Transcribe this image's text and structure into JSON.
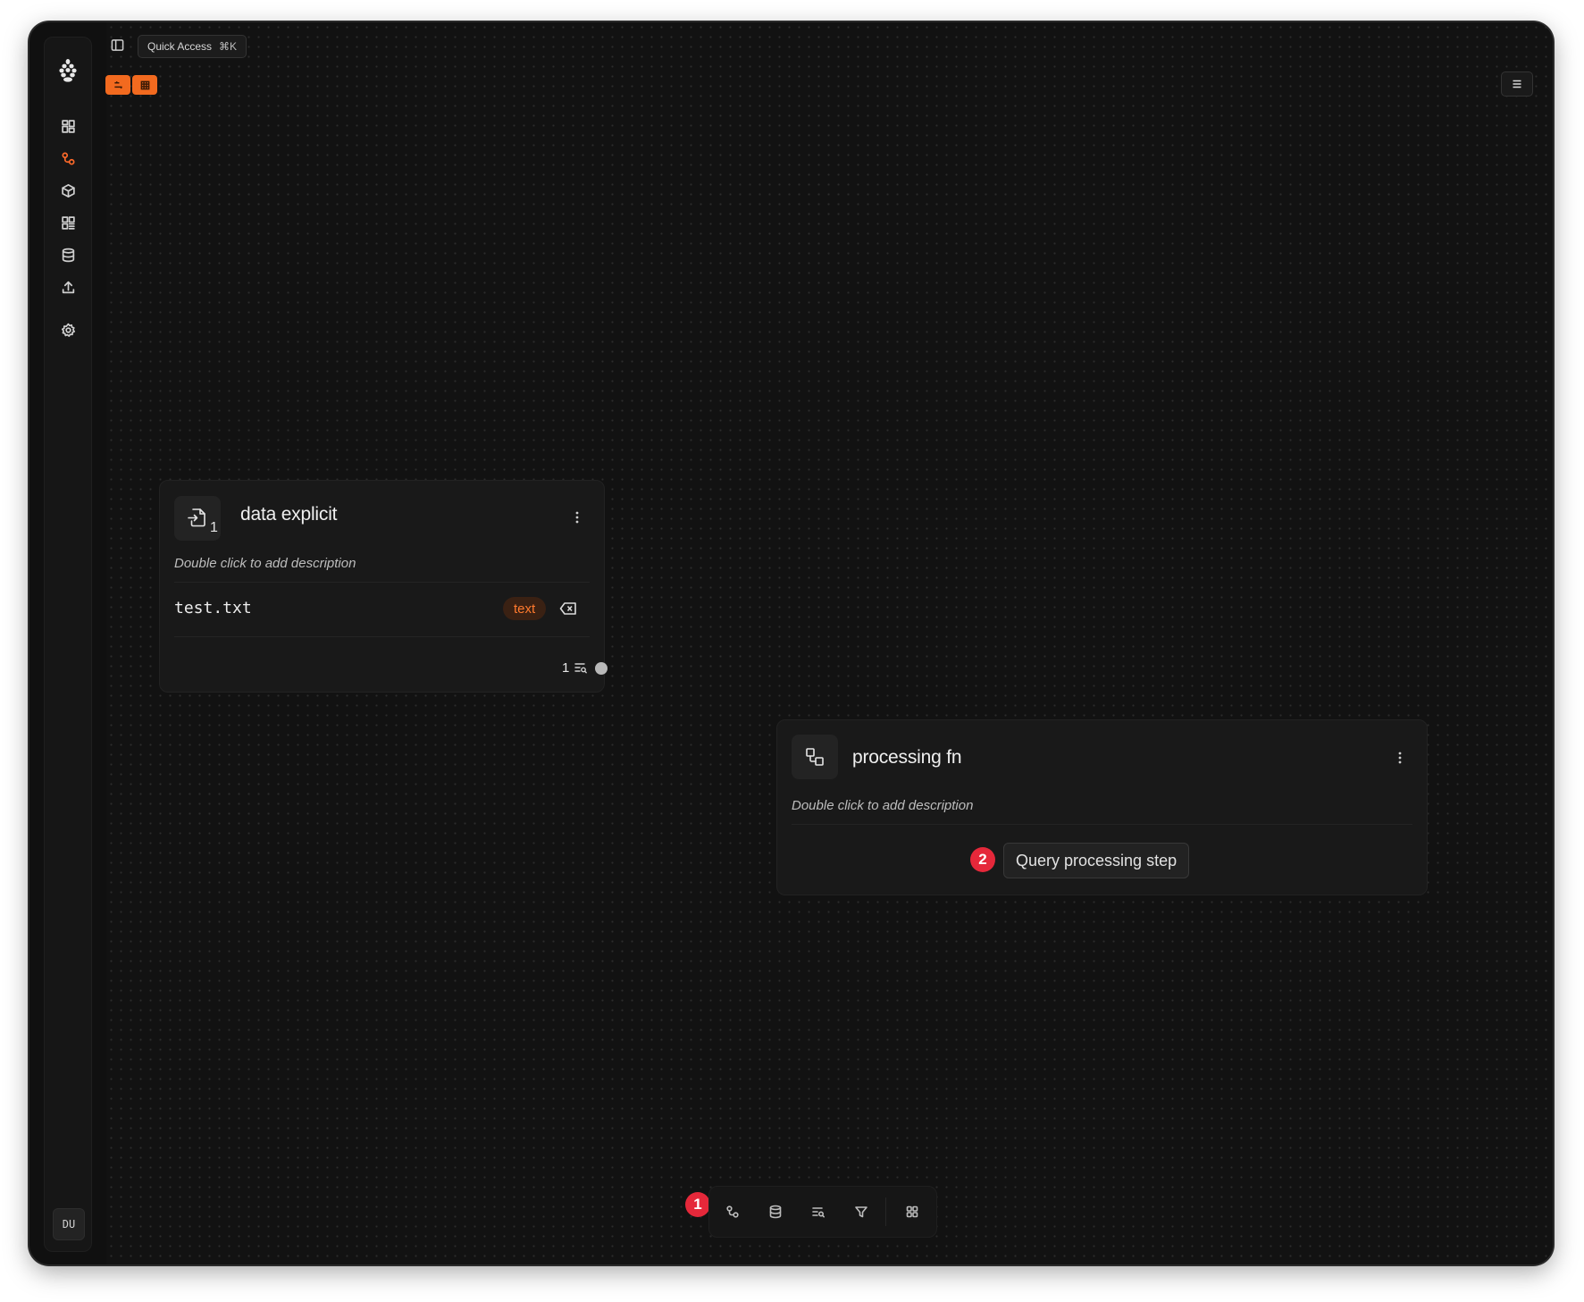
{
  "topbar": {
    "quick_access_label": "Quick Access",
    "quick_access_shortcut": "⌘K"
  },
  "sidebar": {
    "items": [
      {
        "name": "dashboard",
        "icon": "dashboard-icon",
        "active": false
      },
      {
        "name": "pipelines",
        "icon": "pipeline-icon",
        "active": true
      },
      {
        "name": "models",
        "icon": "cube-icon",
        "active": false
      },
      {
        "name": "components",
        "icon": "components-icon",
        "active": false
      },
      {
        "name": "database",
        "icon": "database-icon",
        "active": false
      },
      {
        "name": "upload",
        "icon": "upload-icon",
        "active": false
      },
      {
        "name": "settings",
        "icon": "gear-icon",
        "active": false
      }
    ],
    "avatar_initials": "DU"
  },
  "colors": {
    "accent": "#f26a1f",
    "badge": "#e5283a",
    "background": "#121212",
    "panel": "#191919"
  },
  "nodes": {
    "data": {
      "title": "data explicit",
      "icon_count": "1",
      "description": "Double click to add description",
      "file_name": "test.txt",
      "file_type": "text",
      "output_count": "1"
    },
    "processing": {
      "title": "processing fn",
      "description": "Double click to add description",
      "badge": "2",
      "query_button_label": "Query processing step"
    }
  },
  "bottom_toolbar": {
    "badge": "1",
    "tools": [
      "pipeline-icon",
      "database-icon",
      "query-icon",
      "filter-icon",
      "grid-icon"
    ]
  }
}
